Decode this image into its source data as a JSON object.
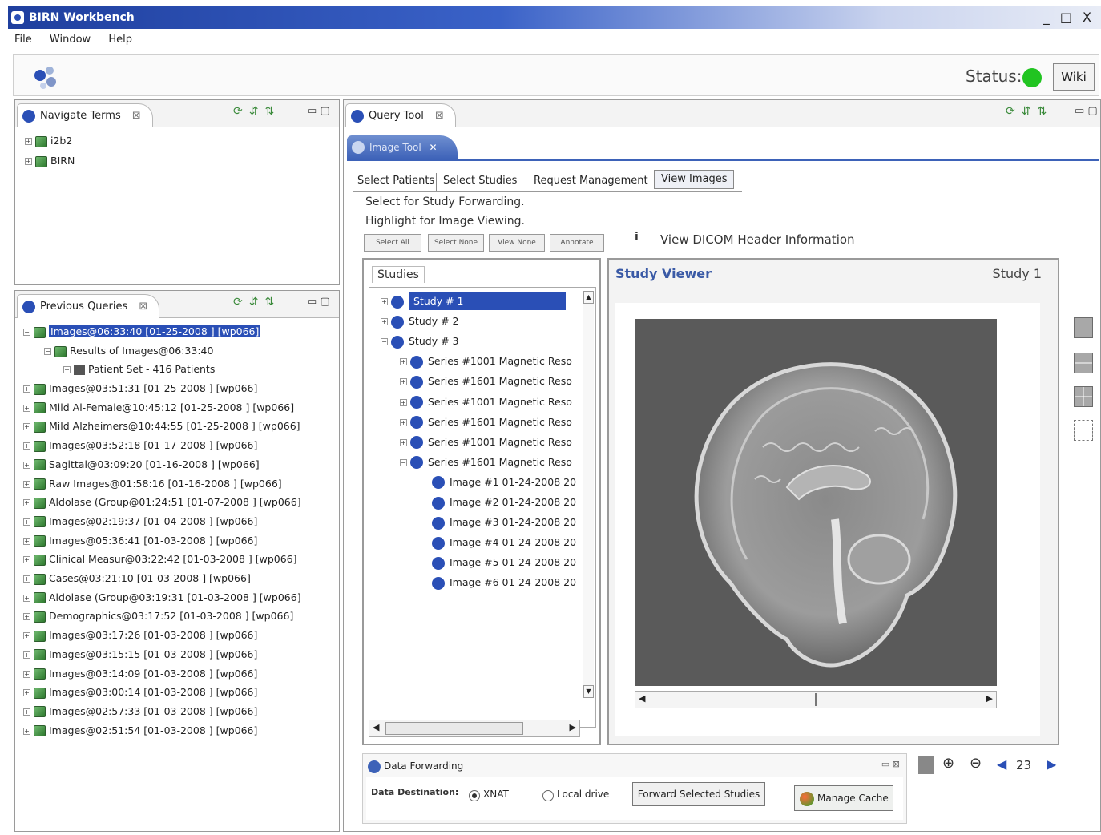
{
  "window": {
    "title": "BIRN Workbench",
    "controls": "_ □ X"
  },
  "menu": [
    "File",
    "Window",
    "Help"
  ],
  "header": {
    "status_label": "Status:",
    "wiki_label": "Wiki",
    "status_color": "#21c421"
  },
  "navigate_terms": {
    "tab_label": "Navigate Terms",
    "items": [
      "i2b2",
      "BIRN"
    ]
  },
  "previous_queries": {
    "tab_label": "Previous Queries",
    "root": "Images@06:33:40 [01-25-2008 ] [wp066]",
    "result": "Results of Images@06:33:40",
    "patient_set": "Patient Set - 416 Patients",
    "items": [
      "Images@03:51:31 [01-25-2008 ] [wp066]",
      "Mild Al-Female@10:45:12 [01-25-2008 ] [wp066]",
      "Mild Alzheimers@10:44:55 [01-25-2008 ] [wp066]",
      "Images@03:52:18 [01-17-2008 ] [wp066]",
      "Sagittal@03:09:20 [01-16-2008 ] [wp066]",
      "Raw Images@01:58:16 [01-16-2008 ] [wp066]",
      "Aldolase (Group@01:24:51 [01-07-2008 ] [wp066]",
      "Images@02:19:37 [01-04-2008 ] [wp066]",
      "Images@05:36:41 [01-03-2008 ] [wp066]",
      "Clinical Measur@03:22:42 [01-03-2008 ] [wp066]",
      "Cases@03:21:10 [01-03-2008 ] [wp066]",
      "Aldolase (Group@03:19:31 [01-03-2008 ] [wp066]",
      "Demographics@03:17:52 [01-03-2008 ] [wp066]",
      "Images@03:17:26 [01-03-2008 ] [wp066]",
      "Images@03:15:15 [01-03-2008 ] [wp066]",
      "Images@03:14:09 [01-03-2008 ] [wp066]",
      "Images@03:00:14 [01-03-2008 ] [wp066]",
      "Images@02:57:33 [01-03-2008 ] [wp066]",
      "Images@02:51:54 [01-03-2008 ] [wp066]"
    ]
  },
  "query_tool": {
    "tab_label": "Query Tool",
    "inner_tab_label": "Image Tool",
    "subtabs": [
      "Select Patients",
      "Select Studies",
      "Request Management",
      "View Images"
    ],
    "instructions": [
      "Select for Study Forwarding.",
      "Highlight for Image Viewing."
    ],
    "buttons": [
      "Select All",
      "Select None",
      "View None",
      "Annotate"
    ],
    "dicom_info_label": "View DICOM Header Information",
    "studies": {
      "title": "Studies",
      "items": [
        "Study # 1",
        "Study # 2",
        "Study # 3"
      ],
      "series": [
        "Series #1001 Magnetic Reso",
        "Series #1601 Magnetic Reso",
        "Series #1001 Magnetic Reso",
        "Series #1601 Magnetic Reso",
        "Series #1001 Magnetic Reso",
        "Series #1601 Magnetic Reso"
      ],
      "images": [
        "Image #1 01-24-2008 20",
        "Image #2 01-24-2008 20",
        "Image #3 01-24-2008 20",
        "Image #4 01-24-2008 20",
        "Image #5 01-24-2008 20",
        "Image #6 01-24-2008 20"
      ]
    },
    "viewer": {
      "title": "Study Viewer",
      "study_label": "Study 1"
    },
    "forwarding": {
      "title": "Data Forwarding",
      "destination_label": "Data Destination:",
      "options": [
        "XNAT",
        "Local drive"
      ],
      "selected_option": "XNAT",
      "forward_button": "Forward Selected Studies",
      "cache_button": "Manage Cache",
      "page_number": "23"
    }
  }
}
